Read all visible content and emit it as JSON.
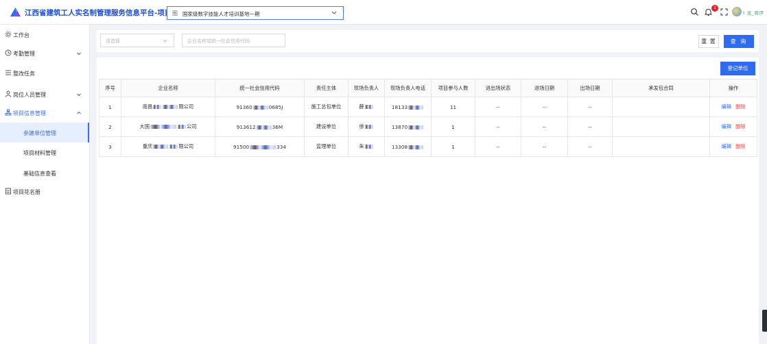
{
  "header": {
    "app_title": "江西省建筑工人实名制管理服务信息平台-项目端",
    "project_prefix": "图",
    "project_name": "国家级数字技能人才培训基地一期",
    "notification_count": "1",
    "username": "t 龙_周伊"
  },
  "sidebar": {
    "items": [
      {
        "label": "工作台"
      },
      {
        "label": "考勤管理"
      },
      {
        "label": "整改任务"
      },
      {
        "label": "岗位人员管理"
      },
      {
        "label": "项目信息管理"
      },
      {
        "label": "参建单位管理"
      },
      {
        "label": "项目材料管理"
      },
      {
        "label": "基础信息查看"
      },
      {
        "label": "项目花名册"
      }
    ]
  },
  "filters": {
    "select_placeholder": "请选择",
    "search_placeholder": "企业名称或统一社会信用代码",
    "reset_label": "重 置",
    "query_label": "查 询"
  },
  "toolbar": {
    "register_label": "登记单位"
  },
  "table": {
    "headers": [
      "序号",
      "企业名称",
      "统一社会信用代码",
      "责任主体",
      "现场负责人",
      "现场负责人电话",
      "项目参与人数",
      "进出场状态",
      "进场日期",
      "出场日期",
      "承发包合同",
      "操作"
    ],
    "rows": [
      {
        "index": "1",
        "name_a": "南昌",
        "name_b": "限公司",
        "code_a": "91360",
        "code_b": "0685J",
        "role": "施工总包单位",
        "person": "薛",
        "phone": "18133",
        "count": "11",
        "status": "--",
        "in_date": "--",
        "out_date": "--",
        "contract": ""
      },
      {
        "index": "2",
        "name_a": "大国",
        "name_b": "公司",
        "code_a": "913612",
        "code_b": "36M",
        "role": "建设单位",
        "person": "徐",
        "phone": "13870",
        "count": "1",
        "status": "--",
        "in_date": "--",
        "out_date": "--",
        "contract": ""
      },
      {
        "index": "3",
        "name_a": "重庆",
        "name_b": "限公司",
        "code_a": "91500",
        "code_b": "334",
        "role": "监理单位",
        "person": "朱",
        "phone": "13308",
        "count": "1",
        "status": "--",
        "in_date": "--",
        "out_date": "--",
        "contract": ""
      }
    ],
    "edit_label": "编辑",
    "delete_label": "删除"
  },
  "colors": {
    "accent": "#2f6bf0",
    "danger": "#e34b4b",
    "active_bg": "#e6efff"
  }
}
